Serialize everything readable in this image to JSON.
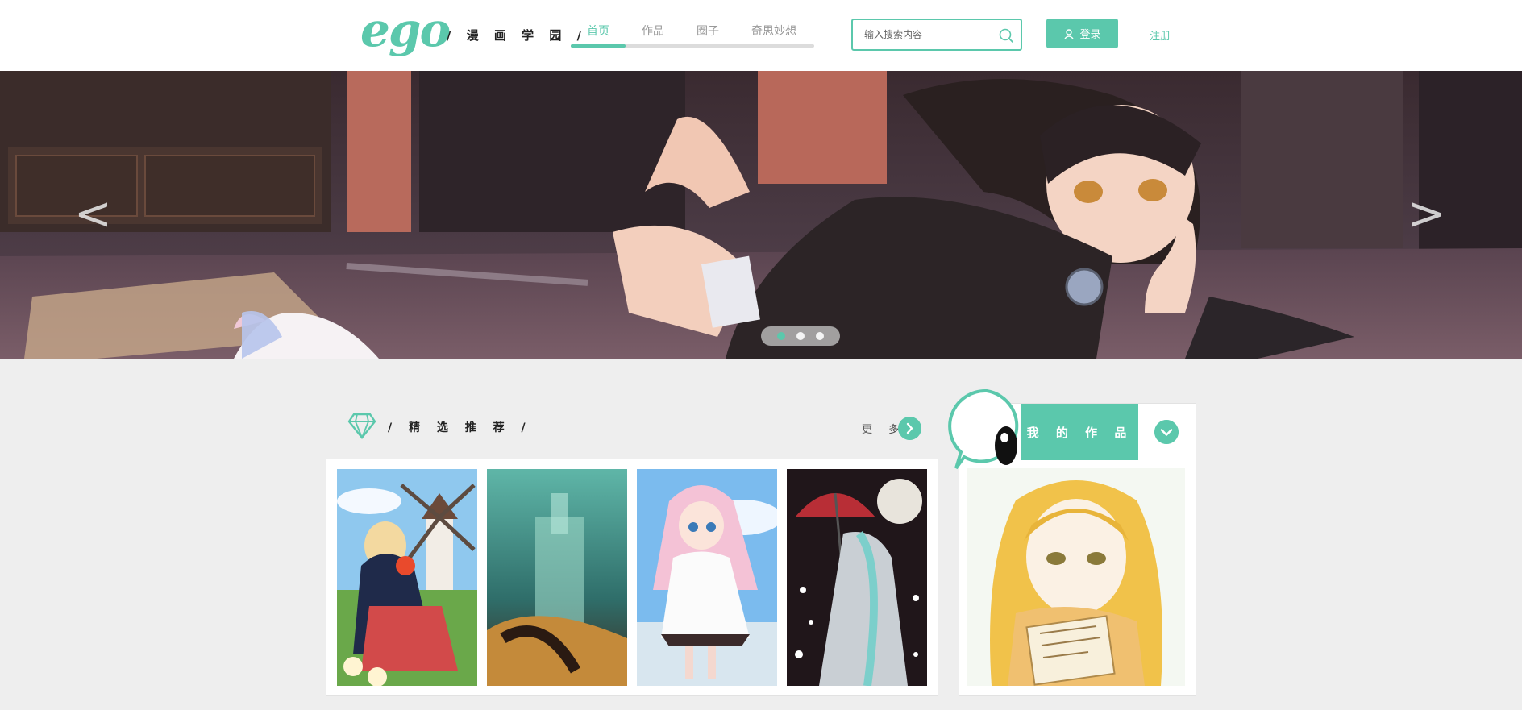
{
  "header": {
    "logo": "ego",
    "slogan": "/ 漫 画 学 园 /",
    "nav": [
      "首页",
      "作品",
      "圈子",
      "奇思妙想"
    ],
    "nav_active_index": 0,
    "search": {
      "placeholder": "输入搜索内容"
    },
    "login_label": "登录",
    "register_label": "注册"
  },
  "banner": {
    "prev_label": "<",
    "next_label": ">",
    "slide_count": 3,
    "active_slide": 1
  },
  "featured": {
    "title": "/ 精 选 推 荐 /",
    "more_label": "更 多",
    "image_count": 4
  },
  "my_works": {
    "title": "我 的 作 品"
  },
  "colors": {
    "accent": "#5bc8ac",
    "page_bg": "#eeeeee",
    "header_bg": "#ffffff"
  },
  "icons": [
    "search-icon",
    "user-icon",
    "diamond-icon",
    "chevron-right-icon",
    "chevron-down-icon"
  ]
}
